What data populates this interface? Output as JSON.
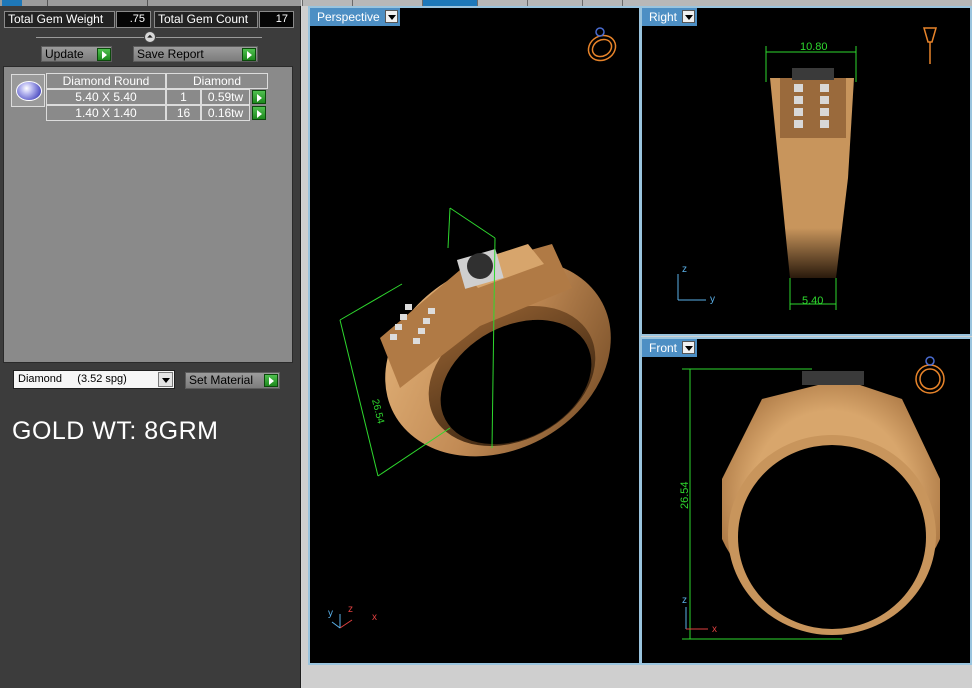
{
  "stats": {
    "gem_weight_label": "Total Gem Weight",
    "gem_weight_value": ".75",
    "gem_count_label": "Total Gem Count",
    "gem_count_value": "17"
  },
  "actions": {
    "update_label": "Update",
    "save_report_label": "Save Report"
  },
  "gem_table": {
    "headers": [
      "Diamond Round",
      "Diamond"
    ],
    "rows": [
      {
        "size": "5.40 X 5.40",
        "count": "1",
        "weight": "0.59tw"
      },
      {
        "size": "1.40 X 1.40",
        "count": "16",
        "weight": "0.16tw"
      }
    ]
  },
  "material": {
    "selected": "Diamond     (3.52 spg)",
    "set_label": "Set Material"
  },
  "annotation": "GOLD WT: 8GRM",
  "viewports": {
    "perspective": {
      "label": "Perspective",
      "dimension": "26.54",
      "axes": {
        "z": "z",
        "y": "y",
        "x": "x"
      }
    },
    "right": {
      "label": "Right",
      "top_dimension": "10.80",
      "bottom_dimension": "5.40",
      "axes": {
        "z": "z",
        "y": "y"
      }
    },
    "front": {
      "label": "Front",
      "dimension": "26.54",
      "axes": {
        "z": "z",
        "x": "x"
      }
    }
  },
  "colors": {
    "panel_bg": "#3c3c3c",
    "viewport_bg": "#000000",
    "viewport_label_bg": "#4d8fc4",
    "viewport_border": "#9ac4de",
    "gold": "#c8955c",
    "dimension_green": "#2ed82e",
    "action_green": "#2a9a2a",
    "icon_orange": "#e8842a"
  },
  "icons": {
    "gem_thumbnail": "round-diamond-icon",
    "collapse": "collapse-knob-icon",
    "dropdown": "chevron-down-icon",
    "apply": "play-arrow-icon",
    "ring_orientation": "ring-orientation-icon",
    "axis_gizmo": "axis-gizmo-icon"
  }
}
